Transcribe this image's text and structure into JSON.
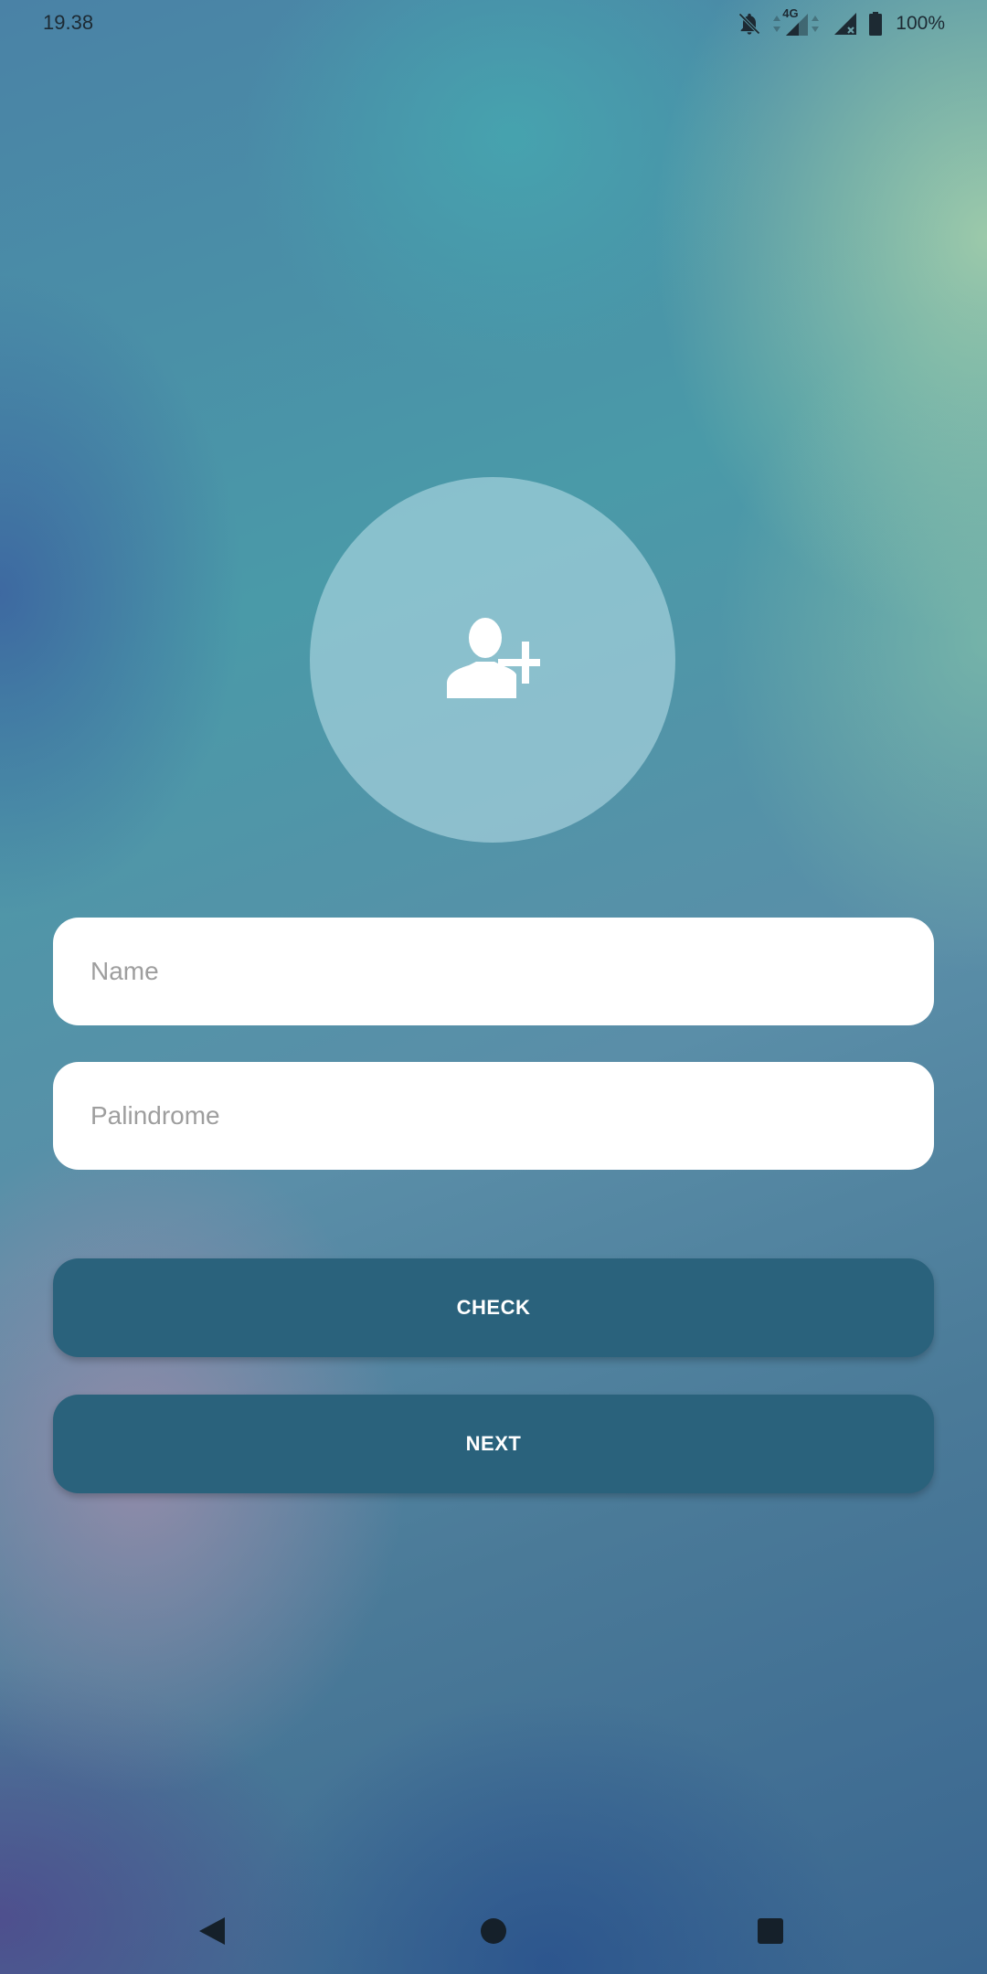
{
  "status_bar": {
    "time": "19.38",
    "network": "4G",
    "battery": "100%",
    "icons": [
      "bell-off-icon",
      "signal-4g-icon",
      "signal-no-sim-icon",
      "battery-icon"
    ]
  },
  "avatar": {
    "icon": "add-user-icon"
  },
  "form": {
    "name_placeholder": "Name",
    "palindrome_placeholder": "Palindrome"
  },
  "buttons": {
    "check_label": "CHECK",
    "next_label": "NEXT",
    "color": "#2a627c"
  },
  "nav_bar": {
    "icons": [
      "back-icon",
      "home-icon",
      "recents-icon"
    ]
  }
}
